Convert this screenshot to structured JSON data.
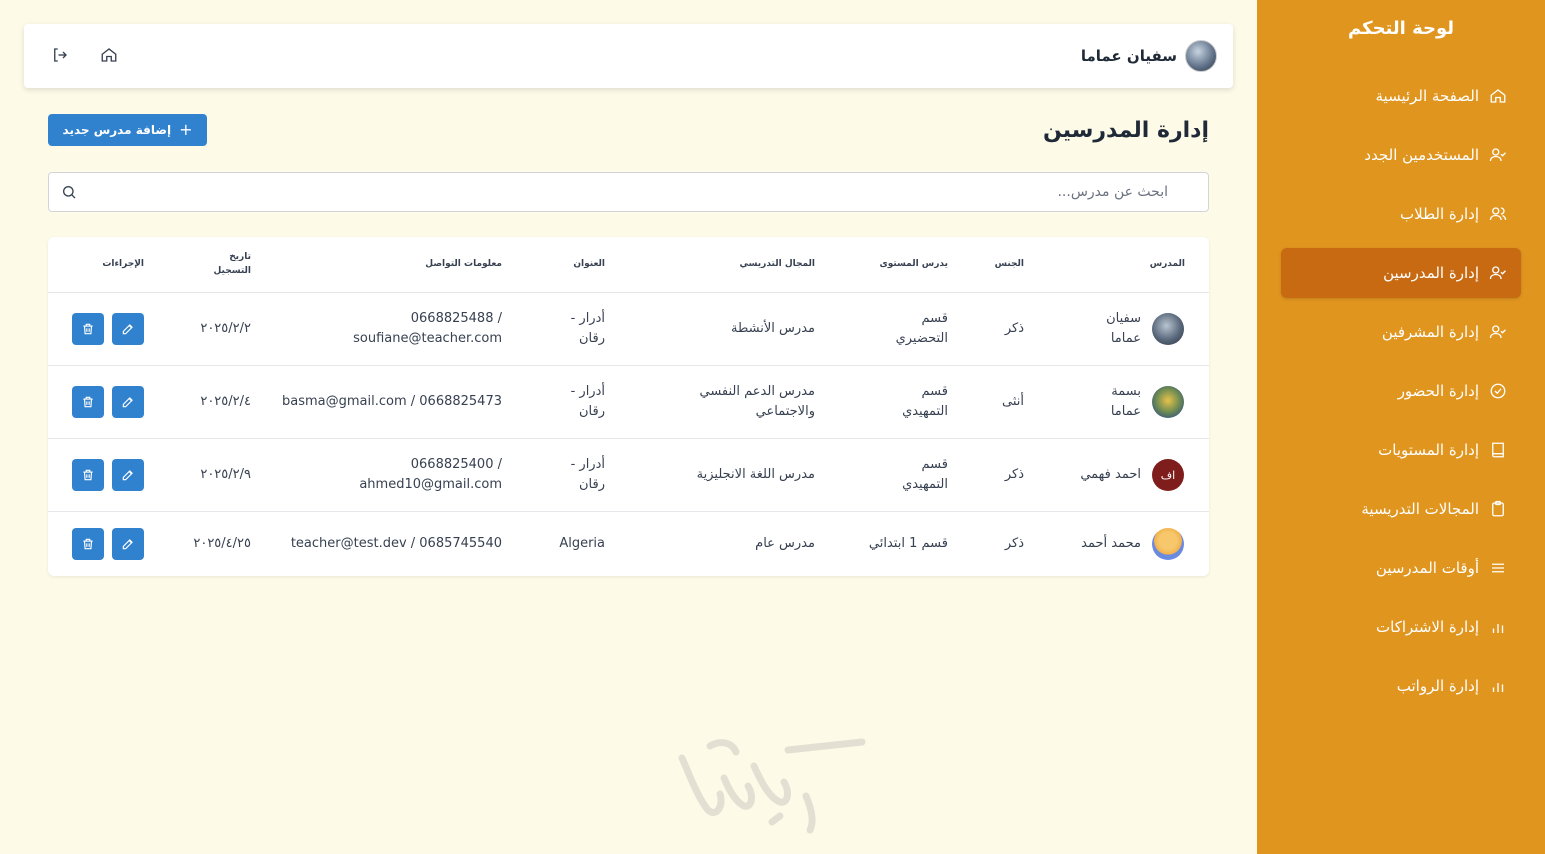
{
  "sidebar": {
    "title": "لوحة التحكم",
    "items": [
      {
        "label": "الصفحة الرئيسية",
        "icon": "home-icon"
      },
      {
        "label": "المستخدمين الجدد",
        "icon": "user-check-icon"
      },
      {
        "label": "إدارة الطلاب",
        "icon": "users-icon"
      },
      {
        "label": "إدارة المدرسين",
        "icon": "user-check-icon",
        "active": true
      },
      {
        "label": "إدارة المشرفين",
        "icon": "user-check-icon"
      },
      {
        "label": "إدارة الحضور",
        "icon": "check-circle-icon"
      },
      {
        "label": "إدارة المستويات",
        "icon": "book-icon"
      },
      {
        "label": "المجالات التدريسية",
        "icon": "clipboard-icon"
      },
      {
        "label": "أوقات المدرسين",
        "icon": "menu-icon"
      },
      {
        "label": "إدارة الاشتراكات",
        "icon": "bar-chart-icon"
      },
      {
        "label": "إدارة الرواتب",
        "icon": "bar-chart-icon"
      }
    ]
  },
  "topbar": {
    "user_name": "سفيان عماما",
    "home_icon": "home-icon",
    "logout_icon": "logout-icon"
  },
  "page": {
    "title": "إدارة المدرسين",
    "add_button": "إضافة مدرس جديد"
  },
  "search": {
    "placeholder": "ابحث عن مدرس..."
  },
  "table": {
    "headers": {
      "teacher": "المدرس",
      "gender": "الجنس",
      "level": "يدرس المستوى",
      "field": "المجال التدريسي",
      "address": "العنوان",
      "contact": "معلومات التواصل",
      "date": "تاريخ التسجيل",
      "actions": "الإجراءات"
    },
    "rows": [
      {
        "name": "سفيان عماما",
        "gender": "ذكر",
        "level": "قسم التحضيري",
        "field": "مدرس الأنشطة",
        "address": "أدرار - رقان",
        "contact": "0668825488 / soufiane@teacher.com",
        "date": "٢٠٢٥/٢/٢"
      },
      {
        "name": "بسمة عماما",
        "gender": "أنثى",
        "level": "قسم التمهيدي",
        "field": "مدرس الدعم النفسي والاجتماعي",
        "address": "أدرار - رقان",
        "contact": "basma@gmail.com / 0668825473",
        "date": "٢٠٢٥/٢/٤"
      },
      {
        "name": "احمد فهمي",
        "initials": "اف",
        "gender": "ذكر",
        "level": "قسم التمهيدي",
        "field": "مدرس اللغة الانجليزية",
        "address": "أدرار - رقان",
        "contact": "0668825400 / ahmed10@gmail.com",
        "date": "٢٠٢٥/٢/٩"
      },
      {
        "name": "محمد أحمد",
        "gender": "ذكر",
        "level": "قسم 1 ابتدائي",
        "field": "مدرس عام",
        "address": "Algeria",
        "contact": "teacher@test.dev / 0685745540",
        "date": "٢٠٢٥/٤/٢٥"
      }
    ]
  },
  "colors": {
    "sidebar": "#e0951f",
    "sidebar_active": "#c86a12",
    "primary": "#3182ce",
    "background": "#fefae8"
  }
}
